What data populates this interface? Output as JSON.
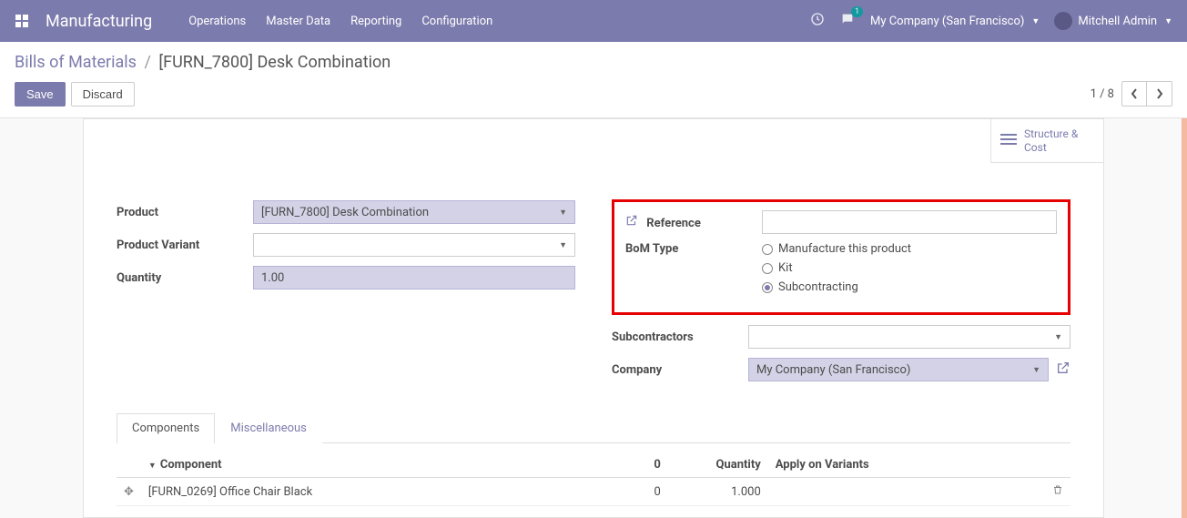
{
  "navbar": {
    "brand": "Manufacturing",
    "menu": [
      "Operations",
      "Master Data",
      "Reporting",
      "Configuration"
    ],
    "chat_badge": "1",
    "company": "My Company (San Francisco)",
    "user": "Mitchell Admin"
  },
  "breadcrumb": {
    "root": "Bills of Materials",
    "current": "[FURN_7800] Desk Combination"
  },
  "buttons": {
    "save": "Save",
    "discard": "Discard"
  },
  "pager": {
    "text": "1 / 8"
  },
  "statbutton": {
    "label": "Structure & Cost"
  },
  "form": {
    "left": {
      "product_label": "Product",
      "product_value": "[FURN_7800] Desk Combination",
      "variant_label": "Product Variant",
      "variant_value": "",
      "qty_label": "Quantity",
      "qty_value": "1.00"
    },
    "right": {
      "reference_label": "Reference",
      "reference_value": "",
      "bomtype_label": "BoM Type",
      "bomtype_options": {
        "manufacture": "Manufacture this product",
        "kit": "Kit",
        "sub": "Subcontracting"
      },
      "subcontractors_label": "Subcontractors",
      "subcontractors_value": "",
      "company_label": "Company",
      "company_value": "My Company (San Francisco)"
    }
  },
  "tabs": {
    "components": "Components",
    "misc": "Miscellaneous"
  },
  "table": {
    "headers": {
      "component": "Component",
      "qty0": "0",
      "qty": "Quantity",
      "variants": "Apply on Variants"
    },
    "rows": [
      {
        "name": "[FURN_0269] Office Chair Black",
        "qty0": "0",
        "qty": "1.000",
        "variants": ""
      }
    ]
  }
}
